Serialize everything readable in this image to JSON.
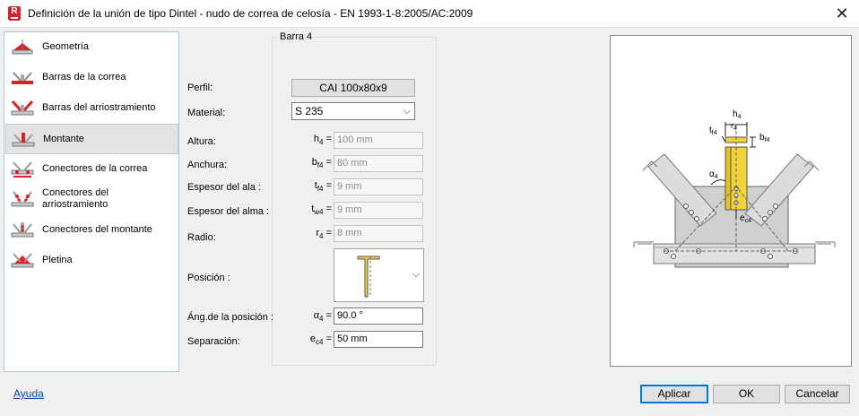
{
  "window": {
    "title": "Definición de la unión de tipo Dintel - nudo de correa de celosía - EN 1993-1-8:2005/AC:2009",
    "app_icon_letter": "R"
  },
  "nav": {
    "items": [
      {
        "label": "Geometría",
        "icon": "geometry-icon"
      },
      {
        "label": "Barras de la correa",
        "icon": "purlin-bars-icon"
      },
      {
        "label": "Barras del arriostramiento",
        "icon": "bracing-bars-icon"
      },
      {
        "label": "Montante",
        "icon": "post-icon",
        "selected": true
      },
      {
        "label": "Conectores de la correa",
        "icon": "purlin-connectors-icon"
      },
      {
        "label": "Conectores del arriostramiento",
        "icon": "bracing-connectors-icon"
      },
      {
        "label": "Conectores del montante",
        "icon": "post-connectors-icon"
      },
      {
        "label": "Pletina",
        "icon": "plate-icon"
      }
    ]
  },
  "group": {
    "title": "Barra 4"
  },
  "form": {
    "perfil_label": "Perfil:",
    "perfil_value": "CAI 100x80x9",
    "material_label": "Material:",
    "material_value": "S 235",
    "altura": {
      "label": "Altura:",
      "sym": "h",
      "sub": "4",
      "eq": "=",
      "value": "100 mm"
    },
    "anchura": {
      "label": "Anchura:",
      "sym": "b",
      "sub": "f4",
      "eq": "=",
      "value": "80 mm"
    },
    "espesor_ala": {
      "label": "Espesor del ala :",
      "sym": "t",
      "sub": "f4",
      "eq": "=",
      "value": "9 mm"
    },
    "espesor_alma": {
      "label": "Espesor del alma :",
      "sym": "t",
      "sub": "w4",
      "eq": "=",
      "value": "9 mm"
    },
    "radio": {
      "label": "Radio:",
      "sym": "r",
      "sub": "4",
      "eq": "=",
      "value": "8 mm"
    },
    "posicion_label": "Posición :",
    "angulo": {
      "label": "Áng.de la posición :",
      "sym": "α",
      "sub": "4",
      "eq": "=",
      "value": "90.0 °"
    },
    "separacion": {
      "label": "Separación:",
      "sym": "e",
      "sub": "c4",
      "eq": "=",
      "value": "50 mm"
    }
  },
  "preview": {
    "labels": {
      "h4": "h4",
      "r4": "r4",
      "tf4": "tf4",
      "bf4": "bf4",
      "alpha4": "α4",
      "ec4": "ec4"
    }
  },
  "footer": {
    "help": "Ayuda",
    "apply": "Aplicar",
    "ok": "OK",
    "cancel": "Cancelar"
  },
  "colors": {
    "accent": "#0078d7",
    "icon_red": "#d6232a",
    "profile_yellow": "#f3d33a",
    "steel": "#c8c8c8"
  }
}
